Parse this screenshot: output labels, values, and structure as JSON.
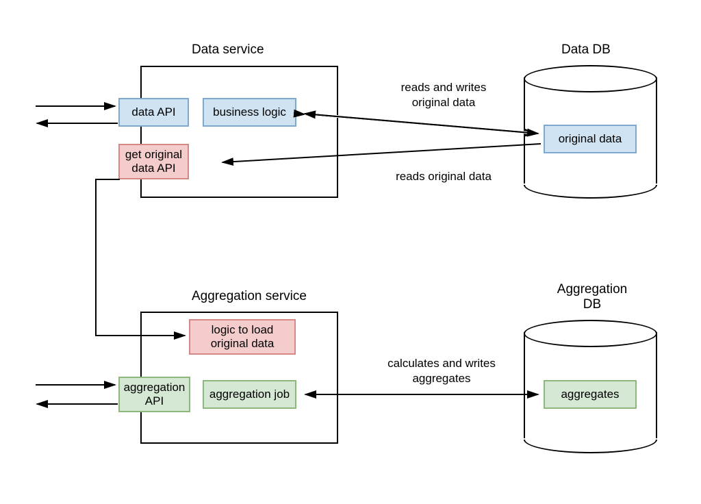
{
  "titles": {
    "data_service": "Data service",
    "data_db": "Data DB",
    "aggregation_service": "Aggregation service",
    "aggregation_db": "Aggregation DB"
  },
  "components": {
    "data_api": "data API",
    "business_logic": "business logic",
    "get_original_data_api": "get original data API",
    "original_data": "original data",
    "logic_load_original": "logic to load original data",
    "aggregation_api": "aggregation API",
    "aggregation_job": "aggregation job",
    "aggregates": "aggregates"
  },
  "edges": {
    "reads_writes_original": "reads and writes original data",
    "reads_original": "reads original data",
    "calc_writes_aggregates": "calculates and writes aggregates"
  }
}
